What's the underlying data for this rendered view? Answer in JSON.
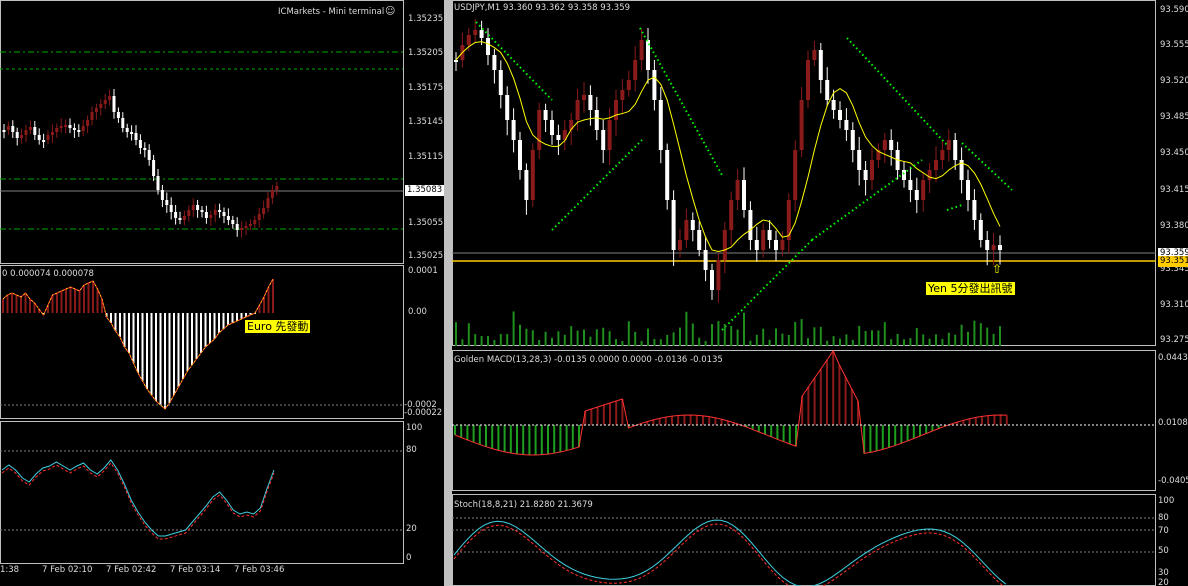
{
  "colors": {
    "background": "#000000",
    "bull": "#8b1a1a",
    "bear": "#ffffff",
    "signal": "#ffff00",
    "stop_green": "#00ff00",
    "volume": "#1f8f1f",
    "level": "#ffcc00",
    "dashed_line": "#00aa00"
  },
  "left_chart": {
    "broker_title": "ICMarkets - Mini terminal",
    "price_ticks": [
      "1.35235",
      "1.35205",
      "1.35175",
      "1.35145",
      "1.35115",
      "1.35083",
      "1.35055",
      "1.35025"
    ],
    "current_price": "1.35083",
    "macd_header": "0 0.000074 0.000078",
    "macd_ticks": [
      "0.0001",
      "0.00",
      "-0.0002",
      "-0.00022"
    ],
    "stoch_ticks": [
      "100",
      "80",
      "20",
      "0"
    ],
    "time_labels": [
      "1:38",
      "7 Feb 02:10",
      "7 Feb 02:42",
      "7 Feb 03:14",
      "7 Feb 03:46"
    ],
    "annotation": "Euro 先發動"
  },
  "right_chart": {
    "symbol_header": "USDJPY,M1  93.360 93.362 93.358 93.359",
    "price_ticks": [
      "93.590",
      "93.555",
      "93.520",
      "93.485",
      "93.450",
      "93.415",
      "93.380",
      "93.345",
      "93.310",
      "93.275"
    ],
    "current_price": "93.351",
    "price_tag_upper": "93.359",
    "annotation": "Yen 5分發出訊號",
    "arrow": "⇧",
    "macd_header": "Golden MACD(13,28,3) -0.0135 0.0000 0.0000 -0.0136 -0.0135",
    "macd_ticks": [
      "0.0443",
      "0.0108",
      "-0.0405"
    ],
    "stoch_header": "Stoch(18,8,21) 21.8280 21.3679",
    "stoch_ticks": [
      "100",
      "80",
      "70",
      "50",
      "30",
      "20"
    ]
  }
}
